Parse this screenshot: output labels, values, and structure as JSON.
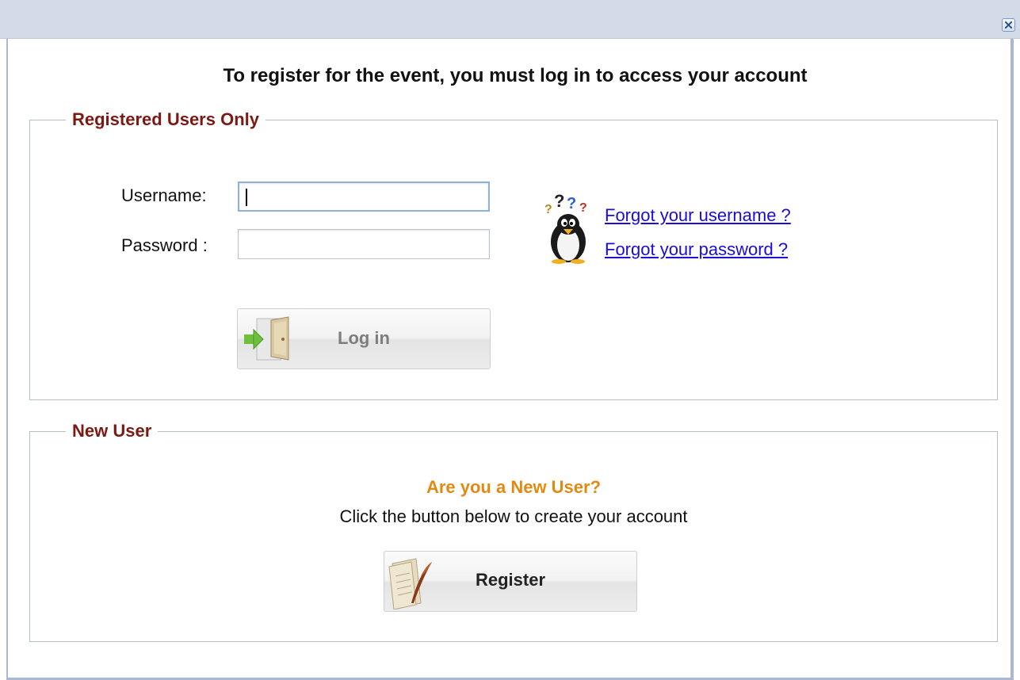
{
  "dialog": {
    "heading": "To register for the event, you must log in to access your account"
  },
  "login_section": {
    "legend": "Registered Users Only",
    "username_label": "Username:",
    "username_value": "",
    "password_label": "Password :",
    "password_value": "",
    "login_button": "Log in",
    "forgot_username": "Forgot your username ?",
    "forgot_password": "Forgot your password ?"
  },
  "new_user_section": {
    "legend": "New User",
    "question": "Are you a New User?",
    "instruction": "Click the button below to create your account",
    "register_button": "Register"
  },
  "icons": {
    "close": "close-icon",
    "help": "penguin-help-icon",
    "login": "door-enter-icon",
    "register": "scroll-quill-icon"
  },
  "colors": {
    "legend": "#7b1a14",
    "link": "#1a0dd6",
    "question": "#e08a12",
    "titlebar": "#d3dbe9"
  }
}
